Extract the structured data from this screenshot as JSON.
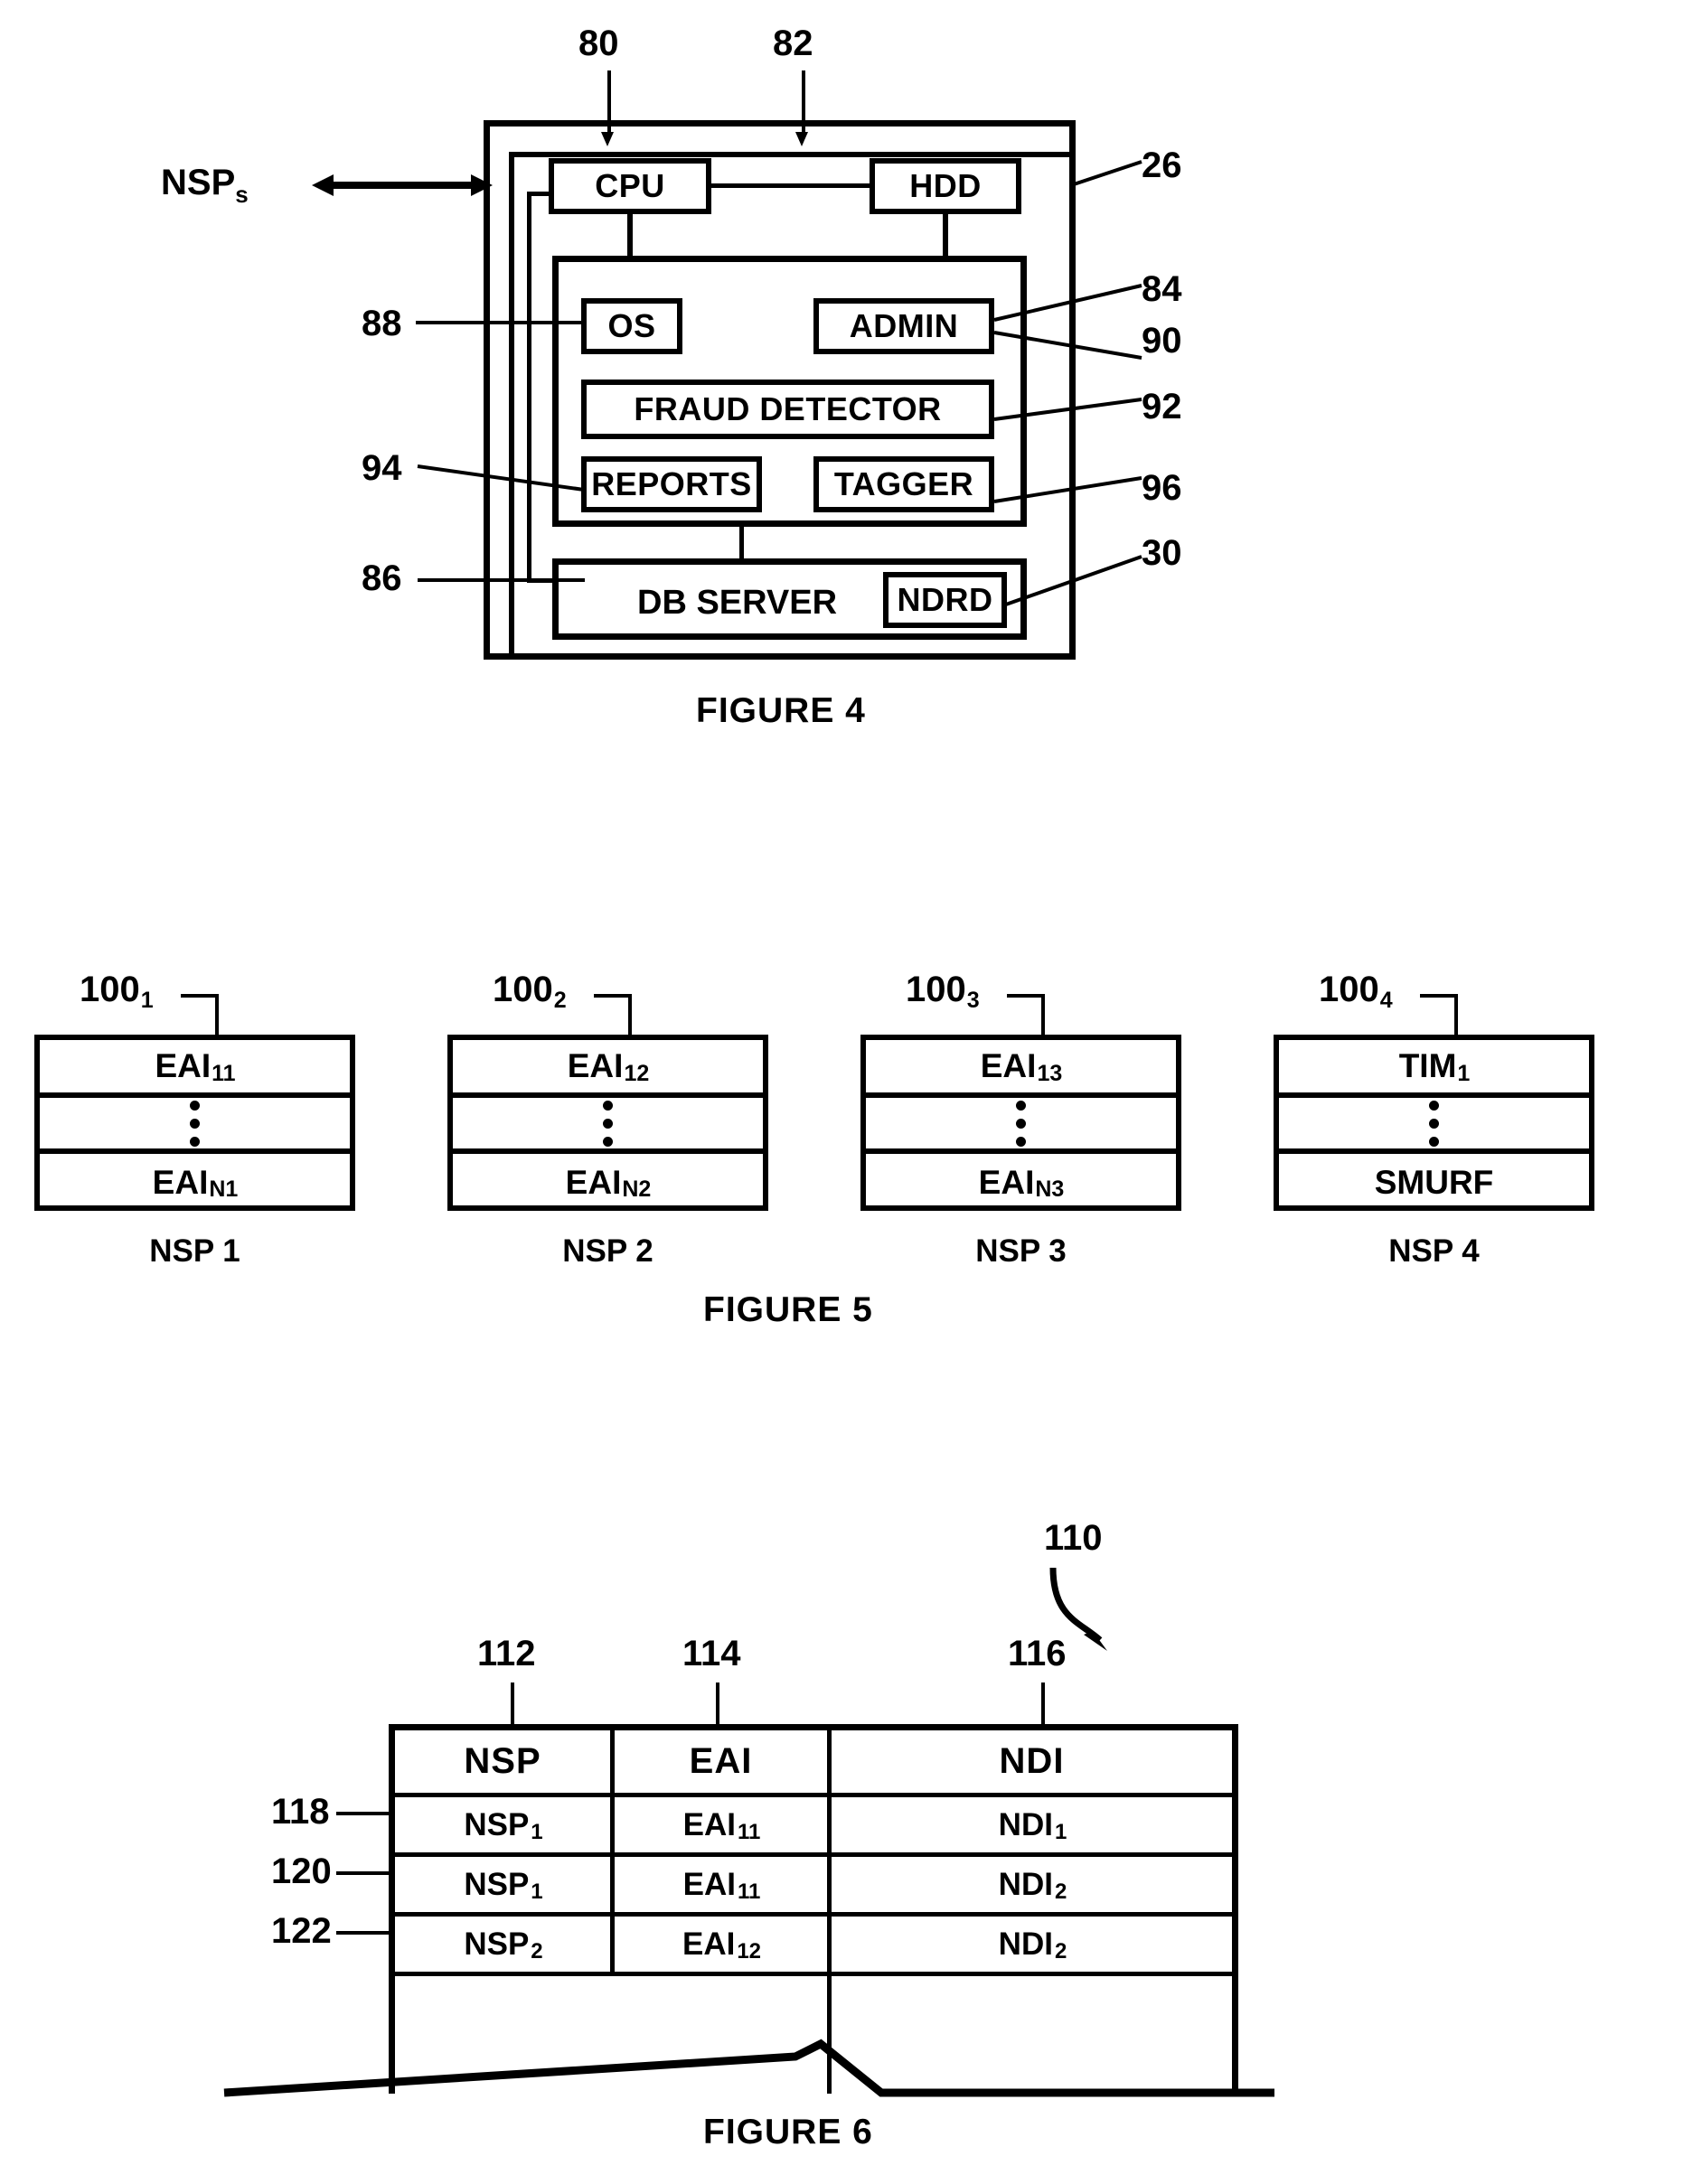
{
  "figure4": {
    "caption": "FIGURE 4",
    "external_label": "NSP",
    "external_label_sub": "s",
    "blocks": {
      "cpu": "CPU",
      "hdd": "HDD",
      "os": "OS",
      "admin": "ADMIN",
      "fraud_detector": "FRAUD DETECTOR",
      "reports": "REPORTS",
      "tagger": "TAGGER",
      "db_server": "DB SERVER",
      "ndrd": "NDRD"
    },
    "refs": {
      "cpu": "80",
      "hdd": "82",
      "enclosure": "26",
      "os": "88",
      "admin_box": "84",
      "admin": "90",
      "fraud_detector": "92",
      "reports": "94",
      "tagger": "96",
      "db_server": "86",
      "ndrd": "30"
    }
  },
  "figure5": {
    "caption": "FIGURE 5",
    "blocks": [
      {
        "ref": "100",
        "ref_sub": "1",
        "top": "EAI",
        "top_sub": "11",
        "bottom": "EAI",
        "bottom_sub": "N1",
        "caption": "NSP 1"
      },
      {
        "ref": "100",
        "ref_sub": "2",
        "top": "EAI",
        "top_sub": "12",
        "bottom": "EAI",
        "bottom_sub": "N2",
        "caption": "NSP 2"
      },
      {
        "ref": "100",
        "ref_sub": "3",
        "top": "EAI",
        "top_sub": "13",
        "bottom": "EAI",
        "bottom_sub": "N3",
        "caption": "NSP 3"
      },
      {
        "ref": "100",
        "ref_sub": "4",
        "top": "TIM",
        "top_sub": "1",
        "bottom": "SMURF",
        "bottom_sub": "",
        "caption": "NSP 4"
      }
    ]
  },
  "figure6": {
    "caption": "FIGURE 6",
    "table_ref": "110",
    "column_refs": [
      "112",
      "114",
      "116"
    ],
    "headers": [
      "NSP",
      "EAI",
      "NDI"
    ],
    "row_refs": [
      "118",
      "120",
      "122"
    ],
    "rows": [
      [
        {
          "text": "NSP",
          "sub": "1"
        },
        {
          "text": "EAI",
          "sub": "11"
        },
        {
          "text": "NDI",
          "sub": "1"
        }
      ],
      [
        {
          "text": "NSP",
          "sub": "1"
        },
        {
          "text": "EAI",
          "sub": "11"
        },
        {
          "text": "NDI",
          "sub": "2"
        }
      ],
      [
        {
          "text": "NSP",
          "sub": "2"
        },
        {
          "text": "EAI",
          "sub": "12"
        },
        {
          "text": "NDI",
          "sub": "2"
        }
      ]
    ]
  }
}
